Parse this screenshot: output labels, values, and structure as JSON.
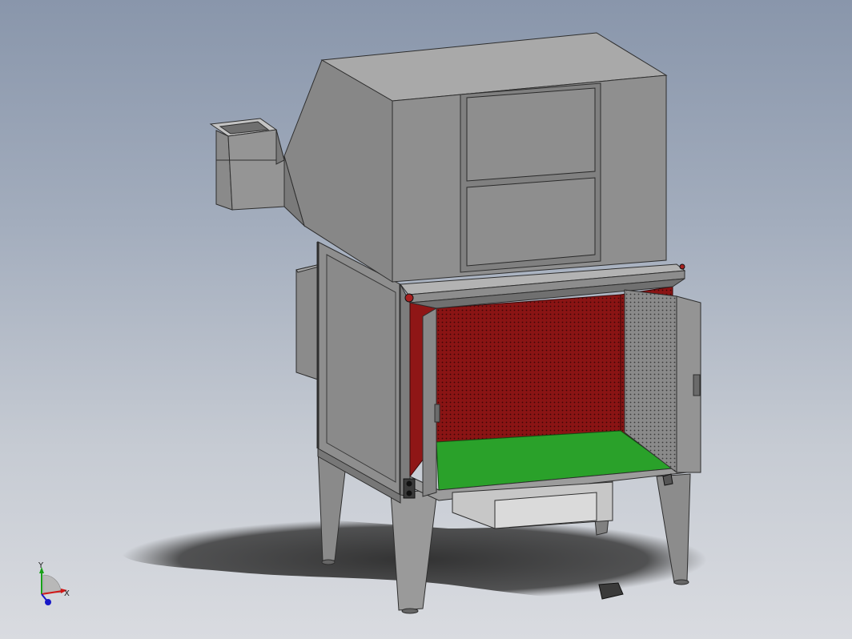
{
  "viewport": {
    "background_top": "#8996ab",
    "background_bottom": "#d9dbe0"
  },
  "model": {
    "body_color": "#7f7f7f",
    "panel_light": "#a9a9a9",
    "panel_mid": "#8e8e8e",
    "interior_back": "#8f1616",
    "floor_color": "#2aa12a"
  },
  "triad": {
    "x_label": "X",
    "y_label": "Y",
    "x_color": "#d01818",
    "y_color": "#18a018",
    "z_color": "#1818c8"
  }
}
